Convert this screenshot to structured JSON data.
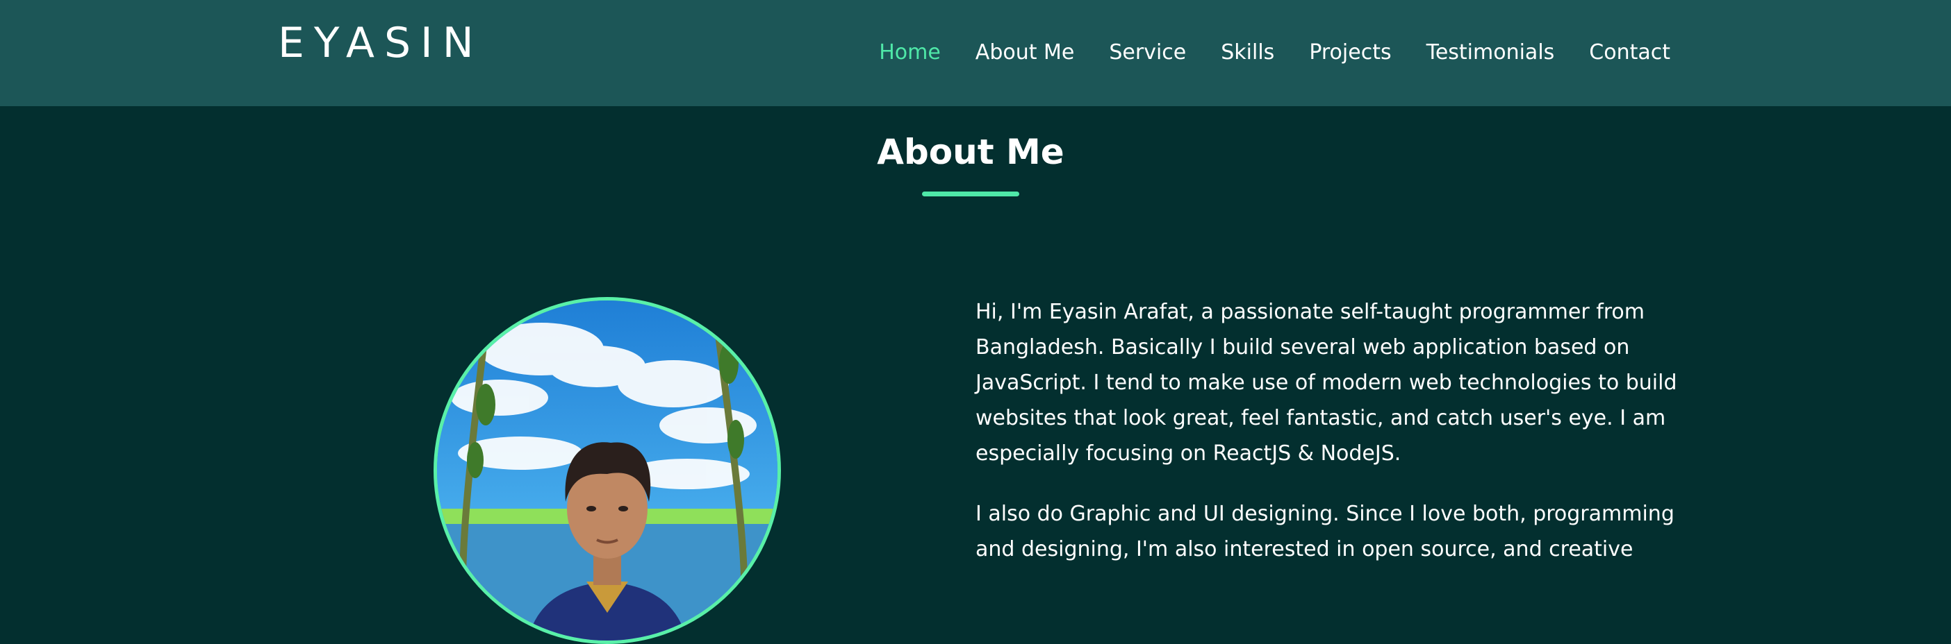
{
  "header": {
    "logo": "EYASIN",
    "nav": [
      {
        "label": "Home",
        "active": true
      },
      {
        "label": "About Me",
        "active": false
      },
      {
        "label": "Service",
        "active": false
      },
      {
        "label": "Skills",
        "active": false
      },
      {
        "label": "Projects",
        "active": false
      },
      {
        "label": "Testimonials",
        "active": false
      },
      {
        "label": "Contact",
        "active": false
      }
    ]
  },
  "about": {
    "title": "About Me",
    "paragraphs": [
      "Hi, I'm Eyasin Arafat, a passionate self-taught programmer from Bangladesh. Basically I build several web application based on JavaScript. I tend to make use of modern web technologies to build websites that look great, feel fantastic, and catch user's eye. I am especially focusing on ReactJS & NodeJS.",
      "I also do Graphic and UI designing. Since I love both, programming and designing, I'm also interested in open source, and creative"
    ]
  },
  "colors": {
    "header_bg": "#1c5657",
    "page_bg": "#032f2f",
    "accent": "#4fe8a8",
    "text": "#ffffff"
  }
}
